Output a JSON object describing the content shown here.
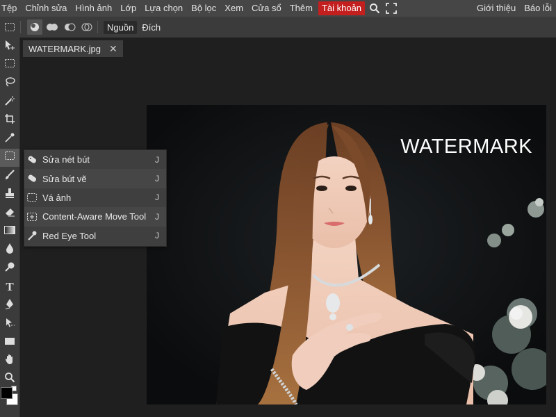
{
  "menubar": {
    "items": [
      "Tệp",
      "Chỉnh sửa",
      "Hình ảnh",
      "Lớp",
      "Lựa chọn",
      "Bộ lọc",
      "Xem",
      "Cửa sổ",
      "Thêm"
    ],
    "account": "Tài khoản",
    "right_items": [
      "Giới thiệu",
      "Báo lỗi"
    ],
    "account_color": "#c41f1f"
  },
  "options": {
    "source_label": "Nguồn",
    "dest_label": "Đích"
  },
  "document": {
    "tab_title": "WATERMARK.jpg",
    "close_glyph": "✕",
    "watermark_text": "WATERMARK"
  },
  "flyout": {
    "items": [
      {
        "label": "Sửa nét bút",
        "shortcut": "J",
        "icon": "spot-healing-brush-icon"
      },
      {
        "label": "Sửa bút vẽ",
        "shortcut": "J",
        "icon": "healing-brush-icon"
      },
      {
        "label": "Vá ảnh",
        "shortcut": "J",
        "icon": "patch-tool-icon"
      },
      {
        "label": "Content-Aware Move Tool",
        "shortcut": "J",
        "icon": "content-aware-move-icon"
      },
      {
        "label": "Red Eye Tool",
        "shortcut": "J",
        "icon": "red-eye-icon"
      }
    ]
  },
  "toolbar": {
    "text_tool_glyph": "T"
  }
}
